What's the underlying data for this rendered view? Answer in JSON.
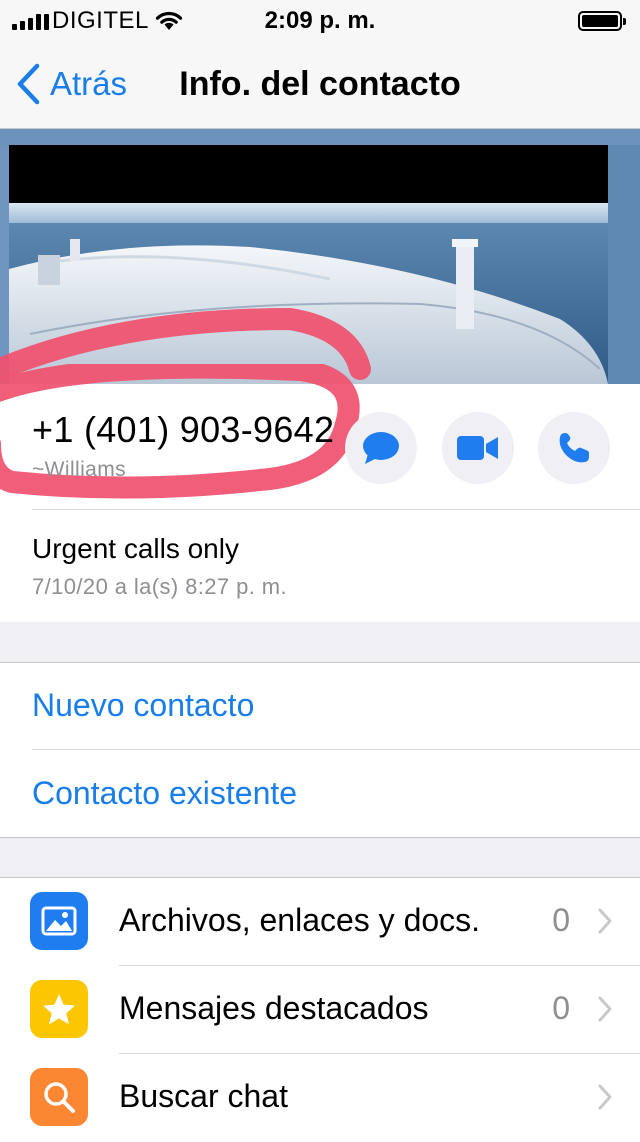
{
  "status_bar": {
    "carrier": "DIGITEL",
    "time": "2:09 p. m."
  },
  "nav": {
    "back_label": "Atrás",
    "title": "Info. del contacto"
  },
  "contact": {
    "phone": "+1 (401) 903-9642",
    "alias": "~Williams",
    "about": "Urgent calls only",
    "about_date": "7/10/20 a la(s) 8:27 p. m.",
    "actions": [
      "message-icon",
      "video-call-icon",
      "phone-icon"
    ]
  },
  "add_contact": {
    "new_contact": "Nuevo contacto",
    "existing_contact": "Contacto existente"
  },
  "menu": [
    {
      "label": "Archivos, enlaces y docs.",
      "count": "0",
      "icon": "photo-icon",
      "color": "#1f7df0"
    },
    {
      "label": "Mensajes destacados",
      "count": "0",
      "icon": "star-icon",
      "color": "#fdc602"
    },
    {
      "label": "Buscar chat",
      "count": "",
      "icon": "search-icon",
      "color": "#fb8733"
    }
  ],
  "colors": {
    "accent": "#1a7ee8",
    "annotation": "#f0506e"
  }
}
